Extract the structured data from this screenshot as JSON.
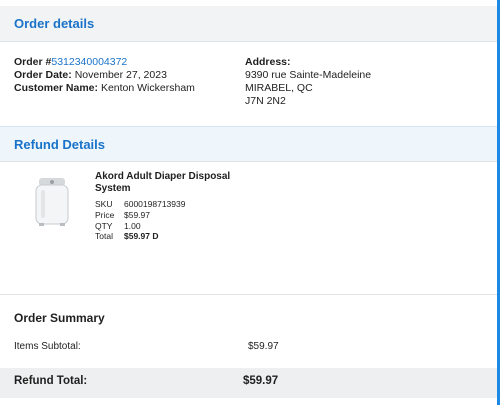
{
  "order_details": {
    "heading": "Order details",
    "order_label": "Order #",
    "order_number": "5312340004372",
    "order_date_label": "Order Date:",
    "order_date": "November 27, 2023",
    "customer_label": "Customer Name:",
    "customer_name": "Kenton Wickersham",
    "address_label": "Address:",
    "address_lines": [
      "9390 rue Sainte-Madeleine",
      "MIRABEL, QC",
      "J7N 2N2"
    ]
  },
  "refund_details": {
    "heading": "Refund Details",
    "item": {
      "title": "Akord Adult Diaper Disposal System",
      "image_icon": "diaper-disposal-bin-image",
      "sku_label": "SKU",
      "sku": "6000198713939",
      "price_label": "Price",
      "price": "$59.97",
      "qty_label": "QTY",
      "qty": "1.00",
      "total_label": "Total",
      "total": "$59.97 D"
    }
  },
  "order_summary": {
    "heading": "Order Summary",
    "subtotal_label": "Items Subtotal:",
    "subtotal": "$59.97",
    "refund_total_label": "Refund Total:",
    "refund_total": "$59.97"
  },
  "colors": {
    "accent": "#1a73c9",
    "rail": "#1e88e5",
    "header_bg": "#f2f3f4",
    "refund_header_bg": "#eef6fb",
    "total_bar_bg": "#eeeff0"
  }
}
